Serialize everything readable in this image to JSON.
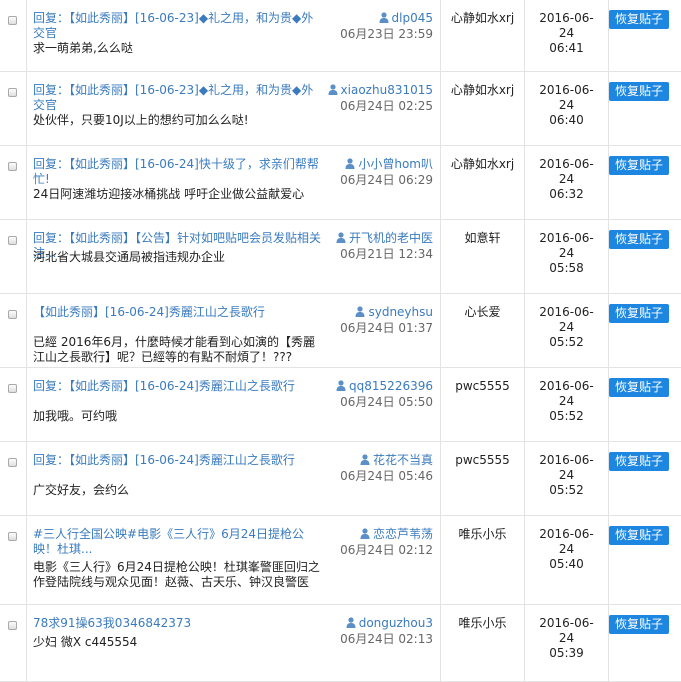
{
  "restore_label": "恢复贴子",
  "rows": [
    {
      "title": "回复：【如此秀丽】[16-06-23]◆礼之用，和为贵◆外交官",
      "content": "求一萌弟弟,么么哒",
      "author": "dlp045",
      "post_time": "06月23日 23:59",
      "operator": "心静如水xrj",
      "deleted_time": [
        "2016-06-",
        "24",
        "06:41"
      ]
    },
    {
      "title": "回复：【如此秀丽】[16-06-23]◆礼之用，和为贵◆外交官",
      "content": "处伙伴，只要10J以上的想约可加么么哒!",
      "author": "xiaozhu831015",
      "post_time": "06月24日 02:25",
      "operator": "心静如水xrj",
      "deleted_time": [
        "2016-06-",
        "24",
        "06:40"
      ]
    },
    {
      "title": "回复：【如此秀丽】[16-06-24]快十级了，求亲们帮帮忙!",
      "content": "24日阿速潍坊迎接冰桶挑战 呼吁企业做公益献爱心",
      "author": "小小曾hom叭",
      "post_time": "06月24日 06:29",
      "operator": "心静如水xrj",
      "deleted_time": [
        "2016-06-",
        "24",
        "06:32"
      ]
    },
    {
      "title": "回复：【如此秀丽】【公告】针对如吧贴吧会员发贴相关注...",
      "content": "河北省大城县交通局被指违规办企业",
      "author": "开飞机的老中医",
      "post_time": "06月21日 12:34",
      "operator": "如意轩",
      "deleted_time": [
        "2016-06-",
        "24",
        "05:58"
      ]
    },
    {
      "title": "【如此秀丽】[16-06-24]秀麗江山之長歌行",
      "content": "已經 2016年6月，什麼時候才能看到心如演的【秀麗江山之長歌行】呢？已經等的有點不耐煩了！???",
      "author": "sydneyhsu",
      "post_time": "06月24日 01:37",
      "operator": "心长爱",
      "deleted_time": [
        "2016-06-",
        "24",
        "05:52"
      ]
    },
    {
      "title": "回复：【如此秀丽】[16-06-24]秀麗江山之長歌行",
      "content": "加我哦。可约哦",
      "author": "qq815226396",
      "post_time": "06月24日 05:50",
      "operator": "pwc5555",
      "deleted_time": [
        "2016-06-",
        "24",
        "05:52"
      ]
    },
    {
      "title": "回复：【如此秀丽】[16-06-24]秀麗江山之長歌行",
      "content": "广交好友，会约么",
      "author": "花花不当真",
      "post_time": "06月24日 05:46",
      "operator": "pwc5555",
      "deleted_time": [
        "2016-06-",
        "24",
        "05:52"
      ]
    },
    {
      "title": "#三人行全国公映#电影《三人行》6月24日提枪公映！杜琪...",
      "content": "电影《三人行》6月24日提枪公映！杜琪峯警匪回归之作登陆院线与观众见面！赵薇、古天乐、钟汉良警医",
      "author": "恋恋芦苇荡",
      "post_time": "06月24日 02:12",
      "operator": "唯乐小乐",
      "deleted_time": [
        "2016-06-",
        "24",
        "05:40"
      ]
    },
    {
      "title": "78求91操63我0346842373",
      "content": "少妇 微X c445554",
      "author": "donguzhou3",
      "post_time": "06月24日 02:13",
      "operator": "唯乐小乐",
      "deleted_time": [
        "2016-06-",
        "24",
        "05:39"
      ]
    }
  ]
}
